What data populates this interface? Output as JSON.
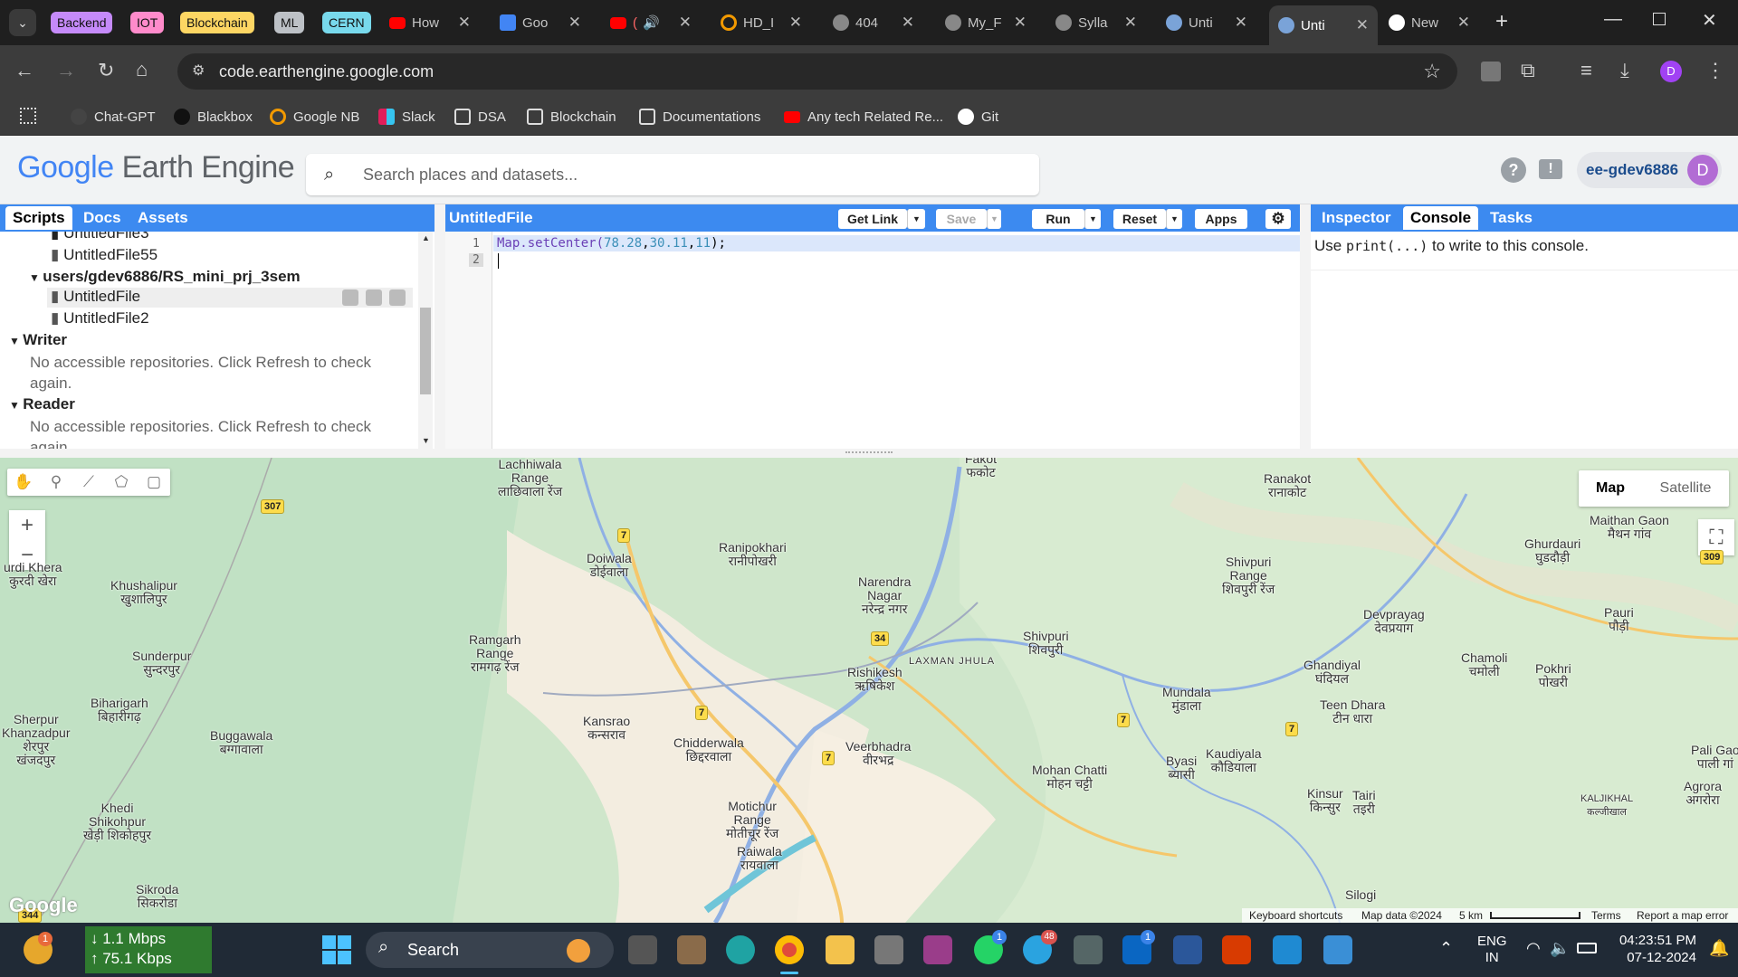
{
  "browser": {
    "chips": [
      {
        "label": "Backend",
        "color": "#c58af9"
      },
      {
        "label": "IOT",
        "color": "#ff8bcb"
      },
      {
        "label": "Blockchain",
        "color": "#fdd663"
      },
      {
        "label": "ML",
        "color": "#bdc1c6"
      },
      {
        "label": "CERN",
        "color": "#78d9ec"
      }
    ],
    "tabs": [
      "How",
      "Goo",
      "(",
      "HD_I",
      "404",
      "My_F",
      "Sylla",
      "Unti",
      "Unti",
      "New"
    ],
    "url": "code.earthengine.google.com",
    "profile_initial": "D",
    "bookmarks": [
      "Chat-GPT",
      "Blackbox",
      "Google NB",
      "Slack",
      "DSA",
      "Blockchain",
      "Documentations",
      "Any tech Related Re...",
      "Git"
    ]
  },
  "gee": {
    "logo_google": "Google",
    "logo_product": "Earth Engine",
    "search_placeholder": "Search places and datasets...",
    "account": "ee-gdev6886",
    "account_initial": "D"
  },
  "left_panel": {
    "tabs": [
      "Scripts",
      "Docs",
      "Assets"
    ],
    "tree": {
      "file_above": "UntitledFile3",
      "file_a": "UntitledFile55",
      "repo": "users/gdev6886/RS_mini_prj_3sem",
      "file_selected": "UntitledFile",
      "file_b": "UntitledFile2",
      "writer_heading": "Writer",
      "writer_msg_1": "No accessible repositories. Click Refresh to check",
      "writer_msg_2": "again.",
      "reader_heading": "Reader",
      "reader_msg_1": "No accessible repositories. Click Refresh to check",
      "reader_msg_2": "again."
    }
  },
  "editor": {
    "filename": "UntitledFile",
    "buttons": {
      "get_link": "Get Link",
      "save": "Save",
      "run": "Run",
      "reset": "Reset",
      "apps": "Apps"
    },
    "line1_no": "1",
    "line2_no": "2",
    "code_fn": "Map.setCenter(",
    "code_a": "78.28",
    "code_b": "30.11",
    "code_c": "11",
    "code_end": ");",
    "comma": ","
  },
  "right_panel": {
    "tabs": [
      "Inspector",
      "Console",
      "Tasks"
    ],
    "console_msg_pre": "Use ",
    "console_msg_code": "print(...)",
    "console_msg_post": " to write to this console."
  },
  "map": {
    "type_map": "Map",
    "type_satellite": "Satellite",
    "zoom_in": "+",
    "zoom_out": "−",
    "places": [
      {
        "en": "Lachhiwala",
        "hi": "Range\nलाछिवाला रेंज"
      },
      {
        "en": "Doiwala",
        "hi": "डोईवाला"
      },
      {
        "en": "Ranipokhari",
        "hi": "रानीपोखरी"
      },
      {
        "en": "Narendra",
        "hi": "Nagar\nनरेन्द्र नगर"
      },
      {
        "en": "Ramgarh",
        "hi": "Range\nरामगढ़ रेंज"
      },
      {
        "en": "Rishikesh",
        "hi": "ऋषिकेश"
      },
      {
        "en": "LAXMAN JHULA",
        "hi": ""
      },
      {
        "en": "Shivpuri",
        "hi": "शिवपुरी"
      },
      {
        "en": "Shivpuri",
        "hi": "Range\nशिवपुरी रेंज"
      },
      {
        "en": "Ranakot",
        "hi": "रानाकोट"
      },
      {
        "en": "Maithan Gaon",
        "hi": "मैथन गांव"
      },
      {
        "en": "Ghurdauri",
        "hi": "घुडदौड़ी"
      },
      {
        "en": "Devprayag",
        "hi": "देवप्रयाग"
      },
      {
        "en": "Pauri",
        "hi": "पौड़ी"
      },
      {
        "en": "Ghandiyal",
        "hi": "घंदियल"
      },
      {
        "en": "Chamoli",
        "hi": "चमोली"
      },
      {
        "en": "Pokhri",
        "hi": "पोखरी"
      },
      {
        "en": "Teen Dhara",
        "hi": "टीन धारा"
      },
      {
        "en": "Mundala",
        "hi": "मुंडाला"
      },
      {
        "en": "Kaudiyala",
        "hi": "कौडियाला"
      },
      {
        "en": "Byasi",
        "hi": "ब्यासी"
      },
      {
        "en": "Mohan Chatti",
        "hi": "मोहन चट्टी"
      },
      {
        "en": "Veerbhadra",
        "hi": "वीरभद्र"
      },
      {
        "en": "Kansrao",
        "hi": "कन्सराव"
      },
      {
        "en": "Chidderwala",
        "hi": "छिद्दरवाला"
      },
      {
        "en": "Motichur",
        "hi": "Range\nमोतीचूर रेंज"
      },
      {
        "en": "Raiwala",
        "hi": "रायवाला"
      },
      {
        "en": "urdi Khera",
        "hi": "कुरदी खेरा"
      },
      {
        "en": "Khushalipur",
        "hi": "खुशालिपुर"
      },
      {
        "en": "Sunderpur",
        "hi": "सुन्दरपुर"
      },
      {
        "en": "Biharigarh",
        "hi": "बिहारीगढ़"
      },
      {
        "en": "Sherpur",
        "hi": "Khanzadpur\nशेरपुर\nखंजदपुर"
      },
      {
        "en": "Buggawala",
        "hi": "बग्गावाला"
      },
      {
        "en": "Khedi",
        "hi": "Shikohpur\nखेड़ी शिकोहपुर"
      },
      {
        "en": "Sikroda",
        "hi": "सिकरोडा"
      },
      {
        "en": "Kinsur",
        "hi": "किन्सुर"
      },
      {
        "en": "Tairi",
        "hi": "तइरी"
      },
      {
        "en": "Silogi",
        "hi": ""
      },
      {
        "en": "Pali Gao",
        "hi": "पाली गां"
      },
      {
        "en": "Agrora",
        "hi": "अगरोरा"
      },
      {
        "en": "KALJIKHAL",
        "hi": "कल्जीखाल"
      },
      {
        "en": "Fakot",
        "hi": "फकोट"
      }
    ],
    "shields": [
      "307",
      "7",
      "34",
      "7",
      "7",
      "7",
      "7",
      "309",
      "344"
    ],
    "footer": {
      "shortcuts": "Keyboard shortcuts",
      "data": "Map data ©2024",
      "scale": "5 km",
      "terms": "Terms",
      "report": "Report a map error"
    },
    "google": "Google"
  },
  "taskbar": {
    "net_down": "↓ 1.1 Mbps",
    "net_up": "↑ 75.1 Kbps",
    "search": "Search",
    "lang1": "ENG",
    "lang2": "IN",
    "time": "04:23:51 PM",
    "date": "07-12-2024",
    "weather_badge": "1",
    "whatsapp_badge": "1",
    "telegram_badge": "48",
    "linkedin_badge": "1"
  }
}
